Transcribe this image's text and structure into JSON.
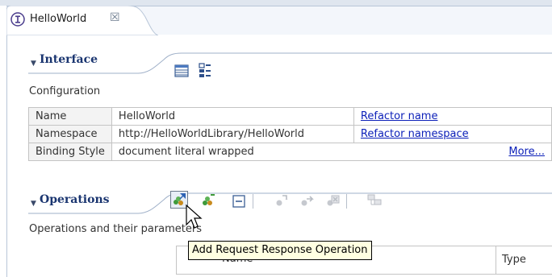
{
  "tab": {
    "title": "HelloWorld",
    "close_glyph": "☒",
    "icon": "interface-icon"
  },
  "interface_section": {
    "title": "Interface",
    "subtitle": "Configuration",
    "toolbar_icons": [
      "table-view-icon",
      "tree-view-icon"
    ],
    "rows": [
      {
        "key": "Name",
        "value": "HelloWorld",
        "action": "Refactor name"
      },
      {
        "key": "Namespace",
        "value": "http://HelloWorldLibrary/HelloWorld",
        "action": "Refactor namespace"
      },
      {
        "key": "Binding Style",
        "value": "document literal wrapped",
        "action": "More..."
      }
    ]
  },
  "operations_section": {
    "title": "Operations",
    "subtitle": "Operations and their parameters",
    "toolbar_icons": [
      "add-request-response-operation-icon",
      "add-one-way-operation-icon",
      "collapse-icon",
      "add-input-icon",
      "add-output-icon",
      "delete-icon",
      "add-fault-icon"
    ],
    "columns": [
      "Name",
      "Type"
    ],
    "tooltip": "Add Request Response Operation"
  },
  "colors": {
    "section_title": "#1a3570",
    "link": "#0a1eb8",
    "tooltip_bg": "#ffffe1"
  }
}
